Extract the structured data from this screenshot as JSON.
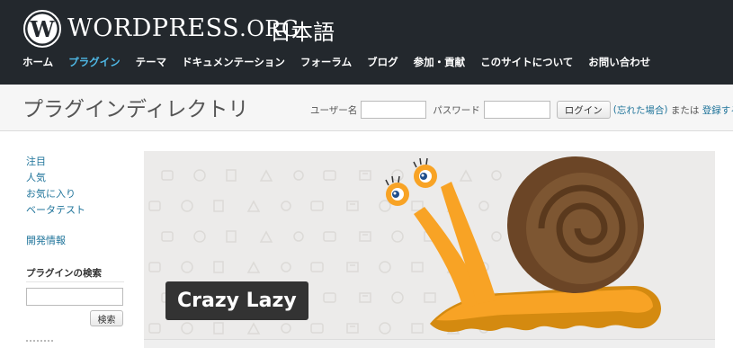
{
  "header": {
    "brand_main": "WORDPRESS",
    "brand_suffix": ".ORG",
    "language": "日本語",
    "nav": [
      {
        "label": "ホーム",
        "active": false
      },
      {
        "label": "プラグイン",
        "active": true
      },
      {
        "label": "テーマ",
        "active": false
      },
      {
        "label": "ドキュメンテーション",
        "active": false
      },
      {
        "label": "フォーラム",
        "active": false
      },
      {
        "label": "ブログ",
        "active": false
      },
      {
        "label": "参加・貢献",
        "active": false
      },
      {
        "label": "このサイトについて",
        "active": false
      },
      {
        "label": "お問い合わせ",
        "active": false
      }
    ],
    "colors": {
      "background": "#23282d",
      "active_link": "#4fb9e6"
    }
  },
  "subheader": {
    "title": "プラグインディレクトリ",
    "username_label": "ユーザー名",
    "password_label": "パスワード",
    "login_button": "ログイン",
    "paren_open": "(",
    "forgot_link": "忘れた場合",
    "paren_close": ")",
    "or_text": " または ",
    "register_link": "登録する"
  },
  "sidebar": {
    "links": [
      "注目",
      "人気",
      "お気に入り",
      "ベータテスト"
    ],
    "dev_link": "開発情報",
    "search_heading": "プラグインの検索",
    "search_button": "検索"
  },
  "banner": {
    "title": "Crazy Lazy",
    "icons": [
      "snail-illustration",
      "plugin-pattern-icons"
    ]
  },
  "icons": {
    "logo": "wordpress-logo-icon"
  }
}
